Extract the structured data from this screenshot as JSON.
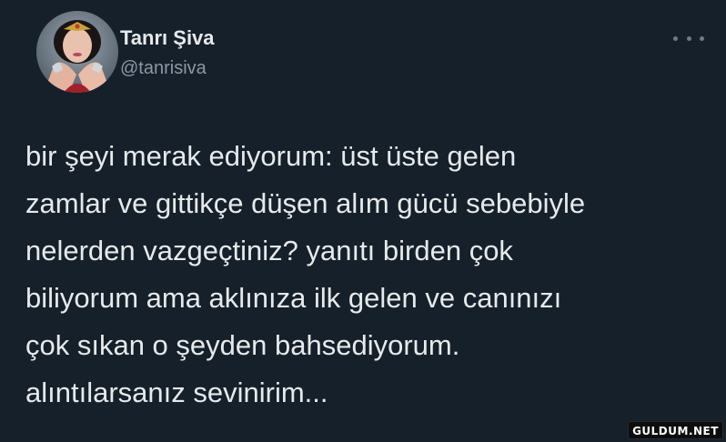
{
  "tweet": {
    "display_name": "Tanrı Şiva",
    "handle": "@tanrisiva",
    "more_icon": "ellipsis-icon",
    "lines": [
      "bir şeyi merak ediyorum: üst üste gelen",
      "zamlar ve gittikçe düşen alım gücü sebebiyle",
      "nelerden vazgeçtiniz? yanıtı birden çok",
      "biliyorum ama aklınıza ilk gelen ve canınızı",
      "çok sıkan o şeyden bahsediyorum.",
      "alıntılarsanız sevinirim..."
    ]
  },
  "watermark": {
    "text": "GULDUM.NET"
  },
  "colors": {
    "background": "#15202b",
    "text": "#e7e9ea",
    "secondary_text": "#8b98a5"
  }
}
